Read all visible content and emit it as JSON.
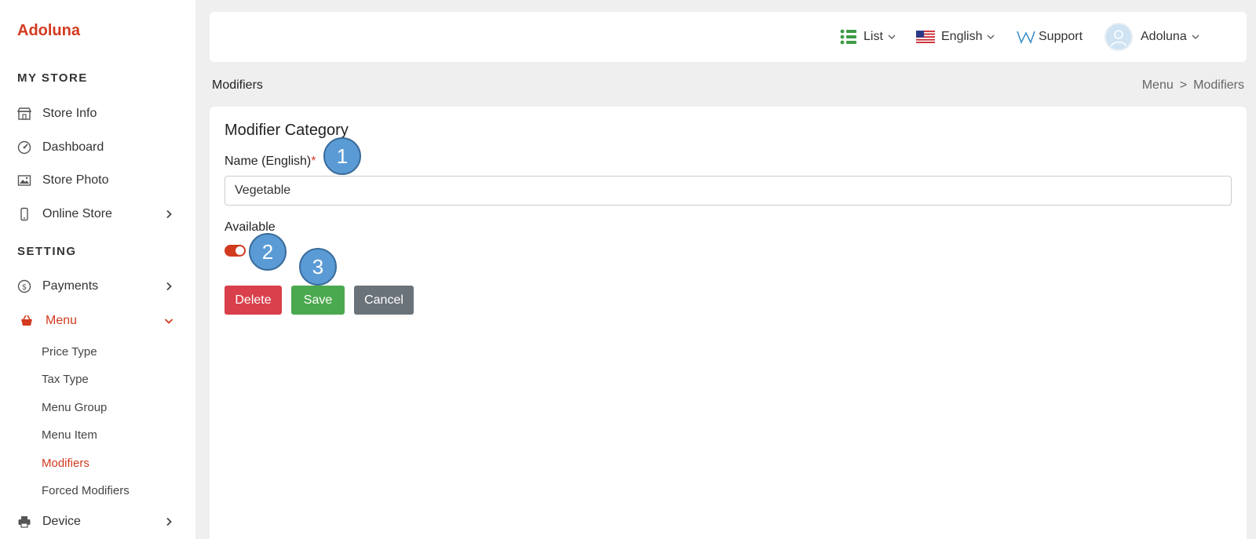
{
  "sidebar": {
    "brand": "Adoluna",
    "section_store": "MY STORE",
    "section_setting": "SETTING",
    "items": [
      {
        "label": "Store Info",
        "icon": "store-icon"
      },
      {
        "label": "Dashboard",
        "icon": "dashboard-icon"
      },
      {
        "label": "Store Photo",
        "icon": "photo-icon"
      },
      {
        "label": "Online Store",
        "icon": "phone-icon"
      },
      {
        "label": "Payments",
        "icon": "dollar-icon"
      },
      {
        "label": "Menu",
        "icon": "basket-icon"
      },
      {
        "label": "Device",
        "icon": "printer-icon"
      }
    ],
    "menu_sub": [
      "Price Type",
      "Tax Type",
      "Menu Group",
      "Menu Item",
      "Modifiers",
      "Forced Modifiers"
    ]
  },
  "topbar": {
    "list_label": "List",
    "language_label": "English",
    "support_label": "Support",
    "user_label": "Adoluna"
  },
  "page": {
    "heading": "Modifiers",
    "breadcrumb": [
      "Menu",
      ">",
      "Modifiers"
    ]
  },
  "form": {
    "title": "Modifier Category",
    "name_label": "Name (English)",
    "required_mark": "*",
    "name_value": "Vegetable",
    "available_label": "Available",
    "available_on": true,
    "delete_label": "Delete",
    "save_label": "Save",
    "cancel_label": "Cancel"
  },
  "markers": [
    "1",
    "2",
    "3"
  ],
  "colors": {
    "brand": "#d23a1f",
    "delete": "#d9404b",
    "save": "#4aa94e",
    "cancel": "#6b737a",
    "marker": "#5b9bd5"
  }
}
